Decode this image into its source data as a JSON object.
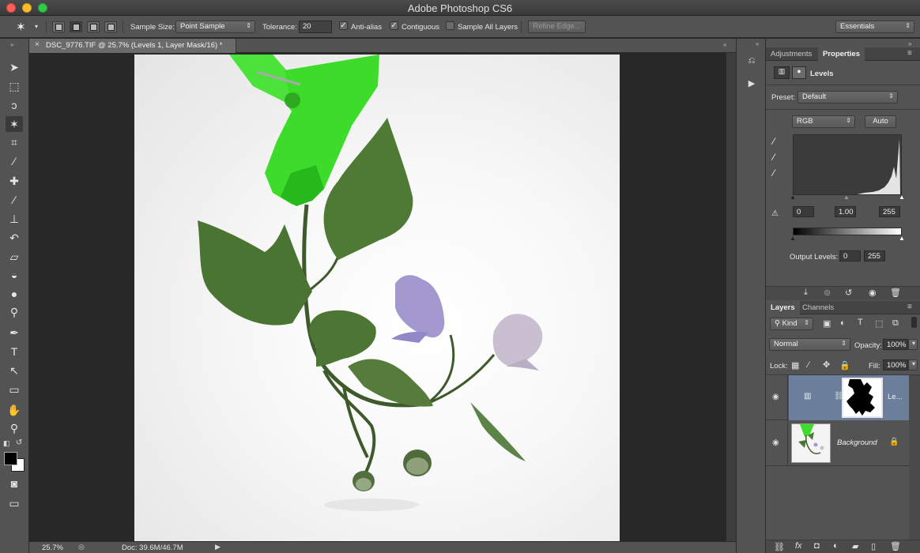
{
  "app": {
    "title": "Adobe Photoshop CS6"
  },
  "options_bar": {
    "sample_size_label": "Sample Size:",
    "sample_size_value": "Point Sample",
    "tolerance_label": "Tolerance:",
    "tolerance_value": "20",
    "anti_alias_label": "Anti-alias",
    "anti_alias_checked": true,
    "contiguous_label": "Contiguous",
    "contiguous_checked": true,
    "sample_all_layers_label": "Sample All Layers",
    "sample_all_layers_checked": false,
    "refine_edge_label": "Refine Edge...",
    "workspace_value": "Essentials"
  },
  "toolbox": {
    "tools": [
      {
        "name": "move-tool-icon",
        "glyph": "➤"
      },
      {
        "name": "rectangular-marquee-icon",
        "glyph": "⬚"
      },
      {
        "name": "lasso-icon",
        "glyph": "ↄ"
      },
      {
        "name": "magic-wand-icon",
        "glyph": "✶"
      },
      {
        "name": "crop-icon",
        "glyph": "⌗"
      },
      {
        "name": "eyedropper-icon",
        "glyph": "⁄"
      },
      {
        "name": "healing-brush-icon",
        "glyph": "✚"
      },
      {
        "name": "brush-icon",
        "glyph": "∕"
      },
      {
        "name": "clone-stamp-icon",
        "glyph": "⊥"
      },
      {
        "name": "history-brush-icon",
        "glyph": "↶"
      },
      {
        "name": "eraser-icon",
        "glyph": "▱"
      },
      {
        "name": "paint-bucket-icon",
        "glyph": "◒"
      },
      {
        "name": "blur-icon",
        "glyph": "●"
      },
      {
        "name": "dodge-icon",
        "glyph": "⚲"
      },
      {
        "name": "pen-icon",
        "glyph": "✒"
      },
      {
        "name": "type-icon",
        "glyph": "T"
      },
      {
        "name": "path-selection-icon",
        "glyph": "↖"
      },
      {
        "name": "rectangle-shape-icon",
        "glyph": "▭"
      },
      {
        "name": "hand-icon",
        "glyph": "✋"
      },
      {
        "name": "zoom-icon",
        "glyph": "⚲"
      }
    ],
    "active_tool": "magic-wand-icon"
  },
  "document": {
    "tab_title": "DSC_9776.TIF @ 25.7% (Levels 1, Layer Mask/16) *",
    "zoom": "25.7%",
    "doc_size": "Doc: 39.6M/46.7M"
  },
  "panels": {
    "tabs_top": [
      {
        "label": "Adjustments",
        "active": false
      },
      {
        "label": "Properties",
        "active": true
      }
    ],
    "properties": {
      "title": "Levels",
      "preset_label": "Preset:",
      "preset_value": "Default",
      "channel_value": "RGB",
      "auto_label": "Auto",
      "input_black": "0",
      "input_gamma": "1.00",
      "input_white": "255",
      "output_label": "Output Levels:",
      "output_black": "0",
      "output_white": "255"
    },
    "tabs_layers": [
      {
        "label": "Layers",
        "active": true
      },
      {
        "label": "Channels",
        "active": false
      }
    ],
    "layers": {
      "filter_kind": "Kind",
      "blend_mode": "Normal",
      "opacity_label": "Opacity:",
      "opacity_value": "100%",
      "lock_label": "Lock:",
      "fill_label": "Fill:",
      "fill_value": "100%",
      "items": [
        {
          "name": "Le...",
          "type": "adjustment-levels",
          "selected": true,
          "visible": true
        },
        {
          "name": "Background",
          "type": "image",
          "selected": false,
          "visible": true,
          "locked": true
        }
      ]
    }
  },
  "colors": {
    "ui_gray": "#535353",
    "canvas_bg": "#282828",
    "selected_layer": "#6b7f9c",
    "clip_green": "#3ddc2a",
    "leaf_green": "#4f7a35",
    "flower_purple": "#a399cf"
  }
}
